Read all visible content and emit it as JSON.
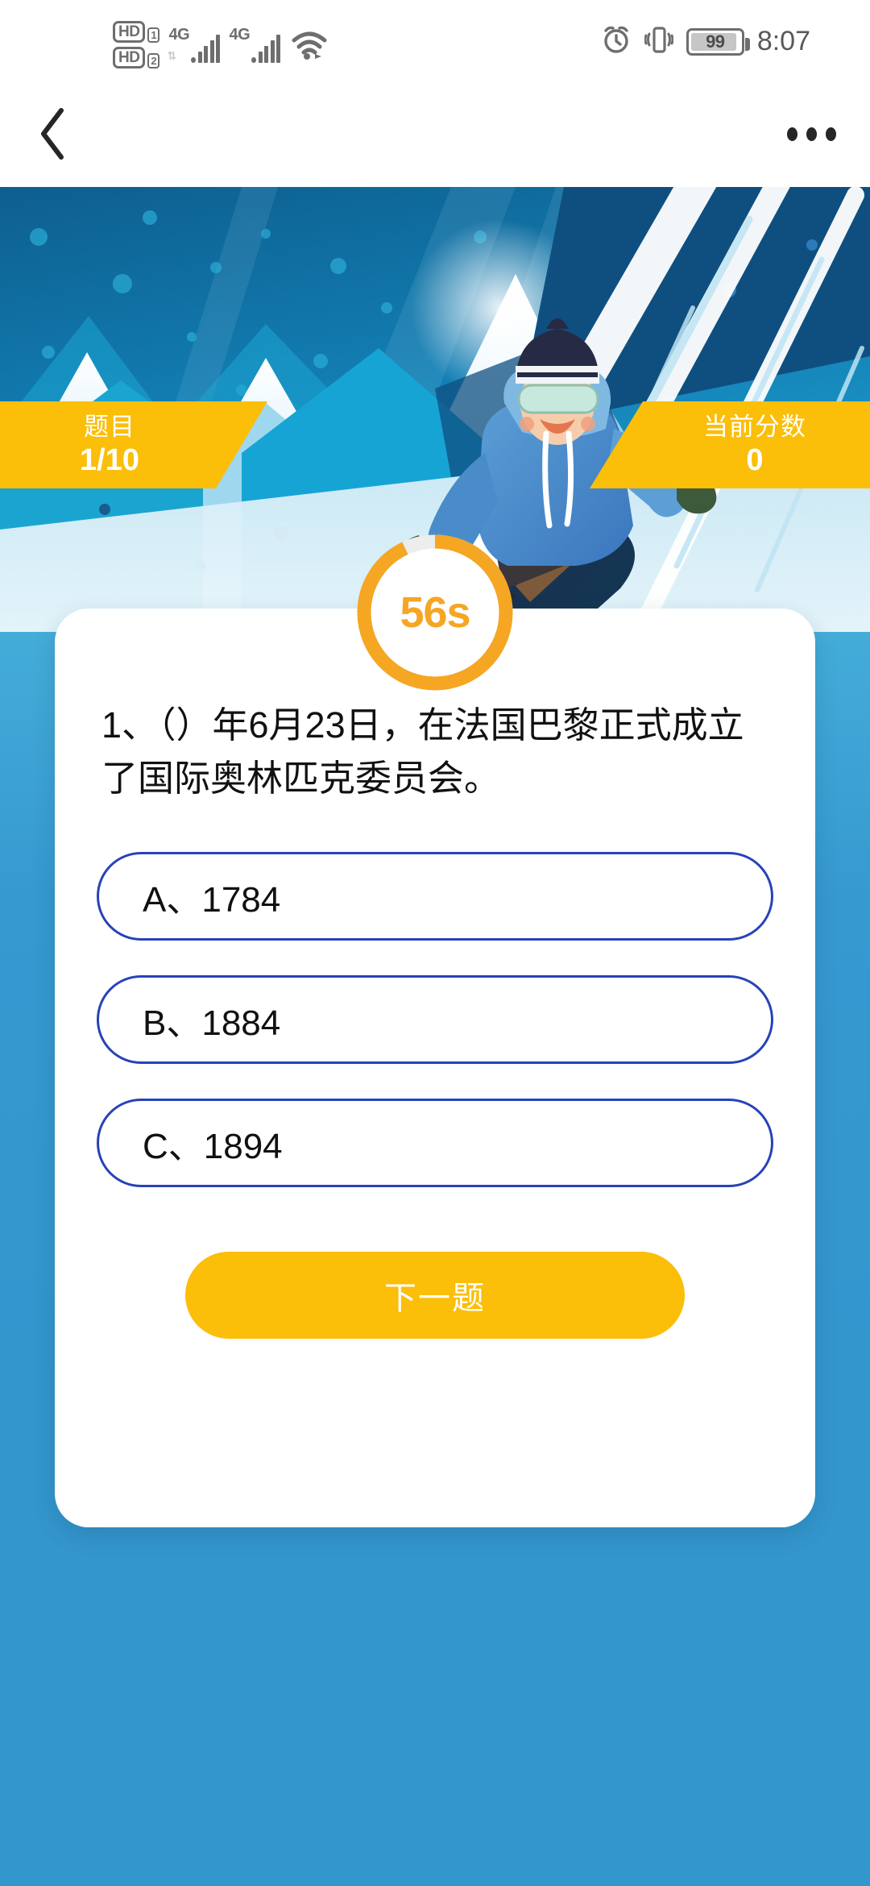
{
  "status_bar": {
    "hd1_label": "HD",
    "hd1_sim": "1",
    "hd2_label": "HD",
    "hd2_sim": "2",
    "network_1": "4G",
    "network_2": "4G",
    "wifi_icon": "wifi-icon",
    "alarm_icon": "alarm-clock-icon",
    "vibrate_icon": "vibrate-icon",
    "battery_level": "99",
    "time": "8:07"
  },
  "nav_bar": {
    "back_icon": "back-chevron-icon",
    "more_icon": "more-options-icon"
  },
  "banner": {
    "illustration": "snowboarder-winter-sports-illustration"
  },
  "ribbons": {
    "question_label": "题目",
    "question_value": "1/10",
    "score_label": "当前分数",
    "score_value": "0"
  },
  "timer": {
    "value": "56s",
    "remaining_seconds": 56,
    "total_seconds": 60,
    "progress_percent": 93,
    "track_color": "#EDEDED",
    "progress_color": "#F5A623"
  },
  "quiz": {
    "question": "1、（）年6月23日，在法国巴黎正式成立了国际奥林匹克委员会。",
    "options": [
      {
        "label": "A、1784"
      },
      {
        "label": "B、1884"
      },
      {
        "label": "C、1894"
      }
    ],
    "next_button": "下一题"
  },
  "colors": {
    "accent_yellow": "#FBBE09",
    "option_border_blue": "#2743B8",
    "page_blue": "#3396CD",
    "timer_orange": "#F5A623"
  }
}
